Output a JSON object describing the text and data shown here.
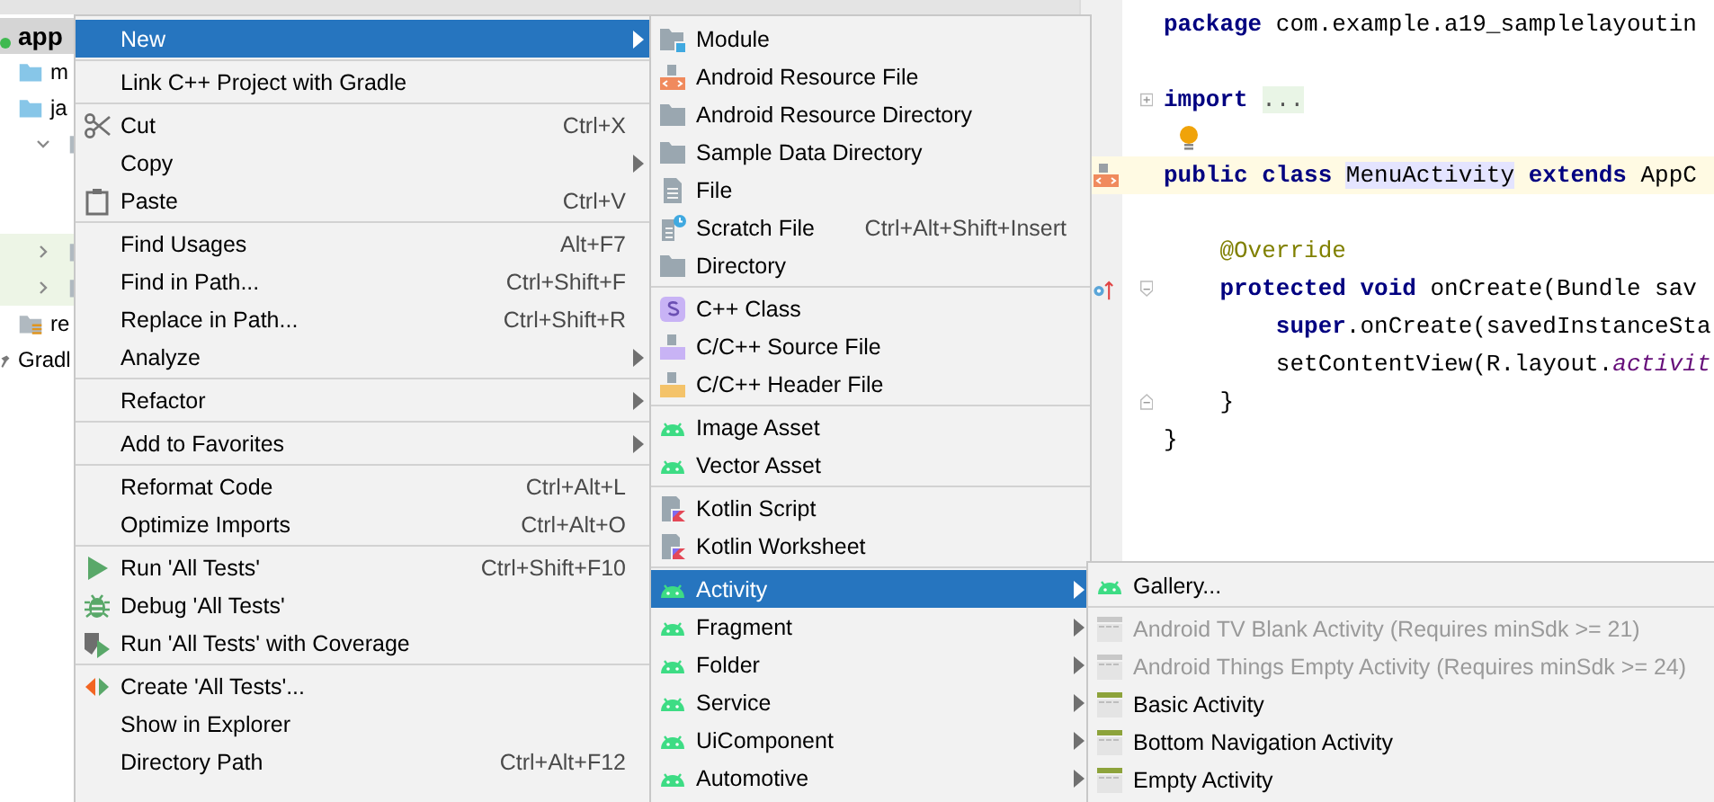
{
  "project_tree": {
    "items": [
      {
        "label": "app",
        "kind": "module",
        "selected": true,
        "highlighted": false,
        "children": [
          {
            "label": "m",
            "kind": "source-folder",
            "selected": false,
            "highlighted": false
          },
          {
            "label": "ja",
            "kind": "source-folder",
            "selected": false,
            "highlighted": false
          },
          {
            "kind": "package",
            "expanded": true,
            "selected": false,
            "highlighted": false
          },
          {
            "kind": "package",
            "expanded": false,
            "selected": false,
            "highlighted": true
          },
          {
            "kind": "package",
            "expanded": false,
            "selected": false,
            "highlighted": true
          },
          {
            "label": "re",
            "kind": "resources",
            "selected": false,
            "highlighted": false
          }
        ]
      },
      {
        "label": "Gradl",
        "kind": "gradle",
        "selected": false,
        "highlighted": false
      }
    ]
  },
  "editor": {
    "lines": [
      {
        "kind": "code",
        "tokens": [
          {
            "text": "package",
            "kind": "keyword"
          },
          {
            "text": " com.example.a19_samplelayoutin",
            "kind": "plain"
          }
        ]
      },
      {
        "kind": "blank"
      },
      {
        "kind": "code",
        "fold_marker": {
          "kind": "collapsed"
        },
        "tokens": [
          {
            "text": "import",
            "kind": "keyword"
          },
          {
            "text": "...",
            "kind": "folded"
          }
        ]
      },
      {
        "kind": "intention"
      },
      {
        "kind": "code",
        "current": true,
        "gutter_icon": {
          "kind": "resource"
        },
        "tokens": [
          {
            "text": "public class",
            "kind": "keyword"
          },
          {
            "text": "MenuActivity",
            "kind": "highlight"
          },
          {
            "text": "extends",
            "kind": "keyword"
          },
          {
            "text": " AppC",
            "kind": "plain"
          }
        ]
      },
      {
        "kind": "blank"
      },
      {
        "kind": "code",
        "tokens": [
          {
            "text": "    @Override",
            "kind": "annotation"
          }
        ]
      },
      {
        "kind": "code",
        "fold_marker": {
          "kind": "start"
        },
        "gutter_icon": {
          "kind": "override"
        },
        "tokens": [
          {
            "text": "    protected void",
            "kind": "keyword"
          },
          {
            "text": " onCreate(Bundle sav",
            "kind": "plain"
          }
        ]
      },
      {
        "kind": "code",
        "tokens": [
          {
            "text": "        super",
            "kind": "keyword"
          },
          {
            "text": ".onCreate(savedInstanceSta",
            "kind": "plain"
          }
        ]
      },
      {
        "kind": "code",
        "tokens": [
          {
            "text": "        setContentView(R.layout.",
            "kind": "plain"
          },
          {
            "text": "activit",
            "kind": "field"
          }
        ]
      },
      {
        "kind": "code",
        "fold_marker": {
          "kind": "end"
        },
        "tokens": [
          {
            "text": "    }",
            "kind": "plain"
          }
        ]
      },
      {
        "kind": "code",
        "tokens": [
          {
            "text": "}",
            "kind": "plain"
          }
        ]
      }
    ]
  },
  "menus": [
    {
      "groups": [
        {
          "items": [
            {
              "label": "New",
              "submenu": true,
              "selected": true
            }
          ]
        },
        {
          "items": [
            {
              "label": "Link C++ Project with Gradle",
              "selected": false
            }
          ]
        },
        {
          "items": [
            {
              "label": "Cut",
              "shortcut": "Ctrl+X",
              "selected": false
            },
            {
              "label": "Copy",
              "submenu": true,
              "selected": false
            },
            {
              "label": "Paste",
              "shortcut": "Ctrl+V",
              "selected": false
            }
          ]
        },
        {
          "items": [
            {
              "label": "Find Usages",
              "shortcut": "Alt+F7",
              "selected": false
            },
            {
              "label": "Find in Path...",
              "shortcut": "Ctrl+Shift+F",
              "selected": false
            },
            {
              "label": "Replace in Path...",
              "shortcut": "Ctrl+Shift+R",
              "selected": false
            },
            {
              "label": "Analyze",
              "submenu": true,
              "selected": false
            }
          ]
        },
        {
          "items": [
            {
              "label": "Refactor",
              "submenu": true,
              "selected": false
            }
          ]
        },
        {
          "items": [
            {
              "label": "Add to Favorites",
              "submenu": true,
              "selected": false
            }
          ]
        },
        {
          "items": [
            {
              "label": "Reformat Code",
              "shortcut": "Ctrl+Alt+L",
              "selected": false
            },
            {
              "label": "Optimize Imports",
              "shortcut": "Ctrl+Alt+O",
              "selected": false
            }
          ]
        },
        {
          "items": [
            {
              "label": "Run 'All Tests'",
              "shortcut": "Ctrl+Shift+F10",
              "selected": false
            },
            {
              "label": "Debug 'All Tests'",
              "selected": false
            },
            {
              "label": "Run 'All Tests' with Coverage",
              "selected": false
            }
          ]
        },
        {
          "items": [
            {
              "label": "Create 'All Tests'...",
              "selected": false
            },
            {
              "label": "Show in Explorer",
              "selected": false
            },
            {
              "label": "Directory Path",
              "shortcut": "Ctrl+Alt+F12",
              "selected": false
            }
          ]
        }
      ]
    },
    {
      "groups": [
        {
          "items": [
            {
              "label": "Module",
              "selected": false
            },
            {
              "label": "Android Resource File",
              "selected": false
            },
            {
              "label": "Android Resource Directory",
              "selected": false
            },
            {
              "label": "Sample Data Directory",
              "selected": false
            },
            {
              "label": "File",
              "selected": false
            },
            {
              "label": "Scratch File",
              "shortcut": "Ctrl+Alt+Shift+Insert",
              "selected": false
            },
            {
              "label": "Directory",
              "selected": false
            }
          ]
        },
        {
          "items": [
            {
              "label": "C++ Class",
              "selected": false
            },
            {
              "label": "C/C++ Source File",
              "selected": false
            },
            {
              "label": "C/C++ Header File",
              "selected": false
            }
          ]
        },
        {
          "items": [
            {
              "label": "Image Asset",
              "selected": false
            },
            {
              "label": "Vector Asset",
              "selected": false
            }
          ]
        },
        {
          "items": [
            {
              "label": "Kotlin Script",
              "selected": false
            },
            {
              "label": "Kotlin Worksheet",
              "selected": false
            }
          ]
        },
        {
          "items": [
            {
              "label": "Activity",
              "submenu": true,
              "selected": true
            },
            {
              "label": "Fragment",
              "submenu": true,
              "selected": false
            },
            {
              "label": "Folder",
              "submenu": true,
              "selected": false
            },
            {
              "label": "Service",
              "submenu": true,
              "selected": false
            },
            {
              "label": "UiComponent",
              "submenu": true,
              "selected": false
            },
            {
              "label": "Automotive",
              "submenu": true,
              "selected": false
            }
          ]
        }
      ]
    },
    {
      "groups": [
        {
          "items": [
            {
              "label": "Gallery...",
              "selected": false,
              "disabled": false
            }
          ]
        },
        {
          "items": [
            {
              "label": "Android TV Blank Activity (Requires minSdk >= 21)",
              "selected": false,
              "disabled": true
            },
            {
              "label": "Android Things Empty Activity (Requires minSdk >= 24)",
              "selected": false,
              "disabled": true
            },
            {
              "label": "Basic Activity",
              "selected": false,
              "disabled": false
            },
            {
              "label": "Bottom Navigation Activity",
              "selected": false,
              "disabled": false
            },
            {
              "label": "Empty Activity",
              "selected": false,
              "disabled": false
            }
          ]
        }
      ]
    }
  ]
}
